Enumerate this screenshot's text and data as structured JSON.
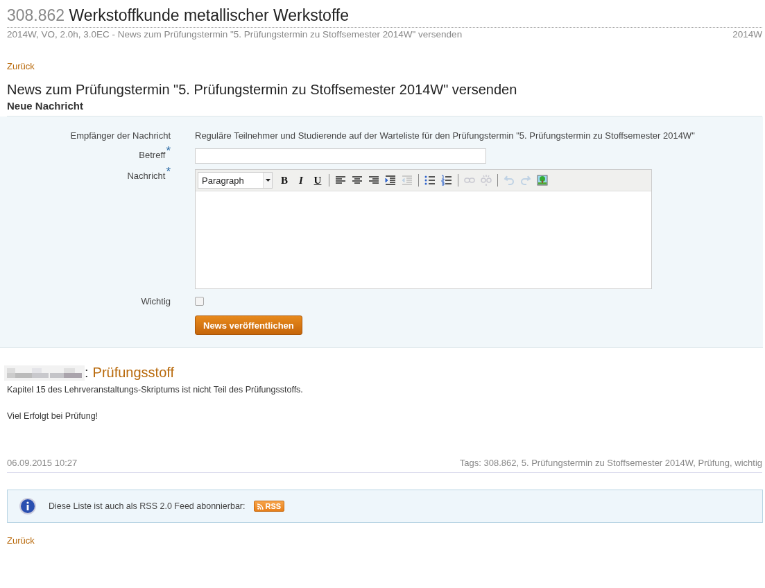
{
  "header": {
    "number": "308.862",
    "title": "Werkstoffkunde metallischer Werkstoffe",
    "subtitle": "2014W, VO, 2.0h, 3.0EC - News zum Prüfungstermin \"5. Prüfungstermin zu Stoffsemester 2014W\" versenden",
    "semester": "2014W"
  },
  "back_link_top": "Zurück",
  "page_title": "News zum Prüfungstermin \"5. Prüfungstermin zu Stoffsemester 2014W\" versenden",
  "section_title": "Neue Nachricht",
  "form": {
    "recipients_label": "Empfänger der Nachricht",
    "recipients": "Reguläre Teilnehmer und Studierende auf der Warteliste für den Prüfungstermin \"5. Prüfungstermin zu Stoffsemester 2014W\"",
    "subject_label": "Betreff",
    "subject_required": "*",
    "message_label": "Nachricht",
    "message_required": "*",
    "format_select": "Paragraph",
    "toolbar": [
      {
        "kind": "bold",
        "label": "B",
        "disabled": false
      },
      {
        "kind": "italic",
        "label": "I",
        "disabled": false
      },
      {
        "kind": "underline",
        "label": "U",
        "disabled": false
      },
      {
        "kind": "sep"
      },
      {
        "kind": "align-left",
        "disabled": false
      },
      {
        "kind": "align-center",
        "disabled": false
      },
      {
        "kind": "align-right",
        "disabled": false
      },
      {
        "kind": "indent",
        "disabled": false
      },
      {
        "kind": "outdent",
        "disabled": true
      },
      {
        "kind": "sep"
      },
      {
        "kind": "bullets",
        "disabled": false
      },
      {
        "kind": "numbers",
        "disabled": false
      },
      {
        "kind": "sep"
      },
      {
        "kind": "link",
        "disabled": true
      },
      {
        "kind": "unlink",
        "disabled": true
      },
      {
        "kind": "sep"
      },
      {
        "kind": "undo",
        "disabled": true
      },
      {
        "kind": "redo",
        "disabled": true
      },
      {
        "kind": "image",
        "disabled": false
      }
    ],
    "important_label": "Wichtig",
    "important_checked": false,
    "submit": "News veröffentlichen"
  },
  "news": {
    "title": "Prüfungsstoff",
    "separator": ":",
    "paragraphs": [
      "Kapitel 15 des Lehrveranstaltungs-Skriptums ist nicht Teil des Prüfungsstoffs.",
      "Viel Erfolgt bei Prüfung!"
    ],
    "date": "06.09.2015 10:27",
    "tags": "Tags: 308.862, 5. Prüfungstermin zu Stoffsemester 2014W, Prüfung, wichtig"
  },
  "rss_note": {
    "text": "Diese Liste ist auch als RSS 2.0 Feed abonnierbar:",
    "badge": "RSS"
  },
  "back_link_bottom": "Zurück"
}
